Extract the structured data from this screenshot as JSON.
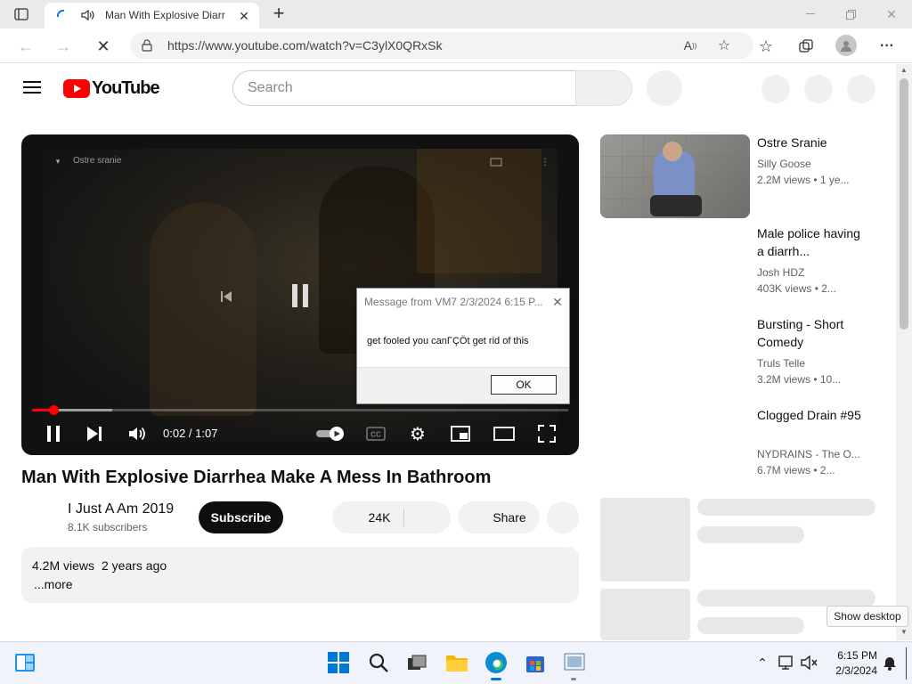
{
  "browser": {
    "tab_title": "Man With Explosive Diarr",
    "url": "https://www.youtube.com/watch?v=C3ylX0QRxSk",
    "new_tab_symbol": "+"
  },
  "youtube": {
    "logo_text": "YouTube",
    "search_placeholder": "Search"
  },
  "player": {
    "time": "0:02 / 1:07",
    "progress_fraction": 0.04,
    "buffered_fraction": 0.15,
    "overlay_channel": "Ostre sranie"
  },
  "dialog": {
    "title": "Message from VM7 2/3/2024 6:15 P...",
    "message": "get fooled you canΓÇÖt get rid of this",
    "ok_label": "OK"
  },
  "video": {
    "title": "Man With Explosive Diarrhea Make A Mess In Bathroom",
    "channel": "I Just A Am 2019",
    "subscribers": "8.1K subscribers",
    "subscribe_label": "Subscribe",
    "likes": "24K",
    "share_label": "Share",
    "views": "4.2M views",
    "age": "2 years ago",
    "more_label": "...more"
  },
  "related": [
    {
      "title": "Ostre Sranie",
      "channel": "Silly Goose",
      "meta": "2.2M views  • 1 ye..."
    },
    {
      "title": "Male police having a diarrh...",
      "channel": "Josh HDZ",
      "meta": "403K views  • 2..."
    },
    {
      "title": "Bursting - Short Comedy",
      "channel": "Truls Telle",
      "meta": "3.2M views  • 10..."
    },
    {
      "title": "Clogged Drain #95",
      "channel": "NYDRAINS - The O...",
      "meta": "6.7M views  • 2..."
    }
  ],
  "taskbar": {
    "time": "6:15 PM",
    "date": "2/3/2024",
    "show_desktop_tooltip": "Show desktop"
  },
  "colors": {
    "youtube_red": "#ff0000",
    "subscribe_bg": "#0f0f0f",
    "progress_red": "#ff0000"
  }
}
